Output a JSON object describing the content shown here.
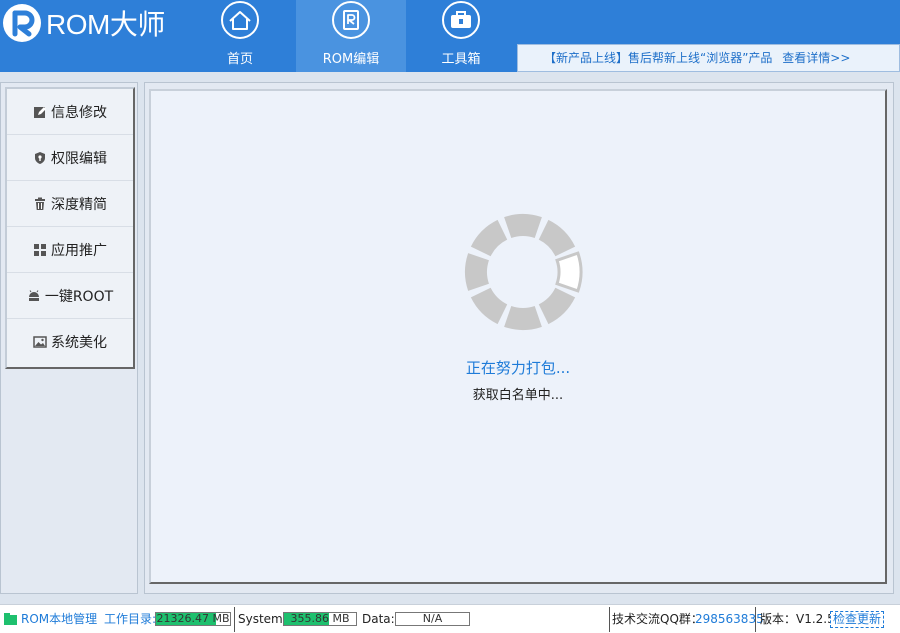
{
  "app": {
    "name": "ROM大师"
  },
  "nav": {
    "tabs": [
      {
        "label": "首页",
        "icon": "home-icon"
      },
      {
        "label": "ROM编辑",
        "icon": "rom-edit-icon",
        "active": true
      },
      {
        "label": "工具箱",
        "icon": "toolbox-icon"
      }
    ]
  },
  "notice": {
    "text": "【新产品上线】售后帮新上线“浏览器”产品",
    "link": "查看详情>>"
  },
  "sidebar": {
    "items": [
      {
        "label": "信息修改",
        "icon": "edit-icon"
      },
      {
        "label": "权限编辑",
        "icon": "shield-icon"
      },
      {
        "label": "深度精简",
        "icon": "trash-icon"
      },
      {
        "label": "应用推广",
        "icon": "apps-icon"
      },
      {
        "label": "一键ROOT",
        "icon": "android-icon"
      },
      {
        "label": "系统美化",
        "icon": "image-icon"
      }
    ]
  },
  "main": {
    "status": "正在努力打包...",
    "substatus": "获取白名单中..."
  },
  "footer": {
    "local_manage": "ROM本地管理",
    "workdir_label": "工作目录:",
    "workdir_value": "21326.47 MB",
    "workdir_fill": 0.81,
    "system_label": "System:",
    "system_value": "355.86 MB",
    "system_fill": 0.62,
    "data_label": "Data:",
    "data_value": "N/A",
    "data_fill": 0,
    "qq_label": "技术交流QQ群：",
    "qq_value": "298563835",
    "version": "版本：V1.2.5",
    "check_update": "检查更新"
  },
  "colors": {
    "header": "#2e7fd8",
    "accent": "#1e7bd8",
    "progress": "#1ec06e",
    "spinner": "#c8c8c8"
  }
}
